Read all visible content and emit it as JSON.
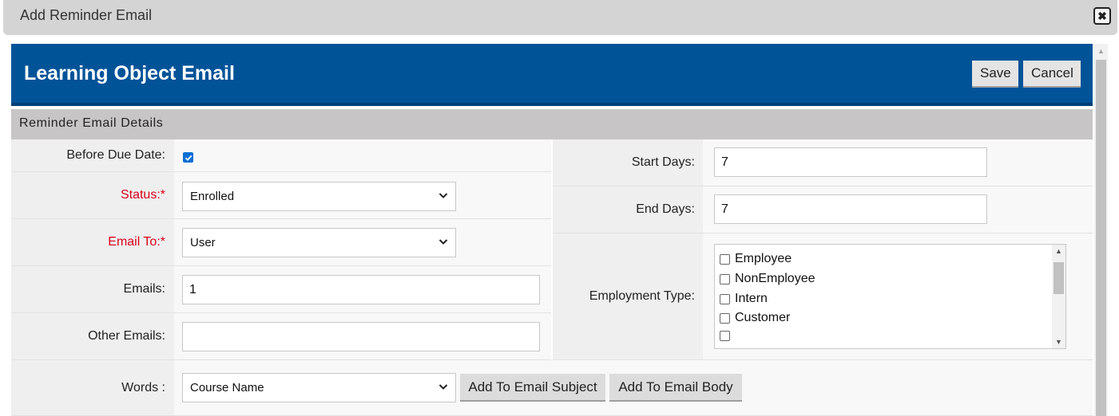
{
  "dialog": {
    "title": "Add Reminder Email"
  },
  "header": {
    "title": "Learning Object Email",
    "save_label": "Save",
    "cancel_label": "Cancel"
  },
  "section": {
    "title": "Reminder Email Details"
  },
  "form": {
    "before_due_date": {
      "label": "Before Due Date:",
      "checked": true
    },
    "status": {
      "label": "Status:*",
      "value": "Enrolled"
    },
    "email_to": {
      "label": "Email To:*",
      "value": "User"
    },
    "emails": {
      "label": "Emails:",
      "value": "1"
    },
    "other_emails": {
      "label": "Other Emails:",
      "value": ""
    },
    "start_days": {
      "label": "Start Days:",
      "value": "7"
    },
    "end_days": {
      "label": "End Days:",
      "value": "7"
    },
    "employment_type": {
      "label": "Employment Type:",
      "options": [
        {
          "label": "Employee",
          "checked": false
        },
        {
          "label": "NonEmployee",
          "checked": false
        },
        {
          "label": "Intern",
          "checked": false
        },
        {
          "label": "Customer",
          "checked": false
        },
        {
          "label": "",
          "checked": false
        }
      ]
    },
    "words": {
      "label": "Words :",
      "value": "Course Name",
      "add_subject_label": "Add To Email Subject",
      "add_body_label": "Add To Email Body"
    }
  },
  "colors": {
    "header_bg": "#015398",
    "required_label": "#d9001b",
    "checkbox_accent": "#0b6fd3"
  },
  "icons": {
    "close": "close-icon",
    "select_arrow": "chevron-down-icon",
    "checkbox_checked": "check-icon"
  }
}
